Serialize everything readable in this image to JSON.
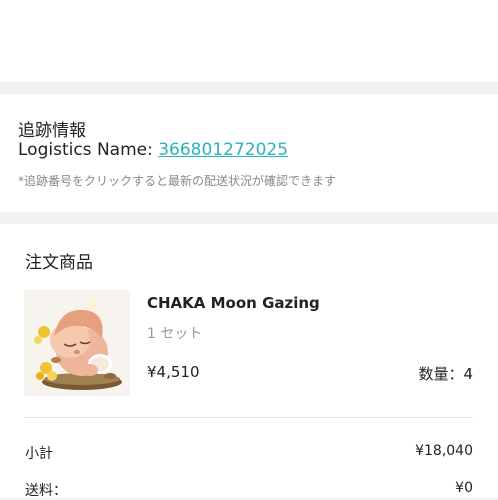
{
  "tracking": {
    "heading": "追跡情報",
    "logistics_label": "Logistics Name: ",
    "tracking_number": "366801272025",
    "note": "*追跡番号をクリックすると最新の配送状況が確認できます"
  },
  "order": {
    "heading": "注文商品",
    "product": {
      "name": "CHAKA Moon Gazing",
      "variant": "1 セット",
      "price": "¥4,510",
      "quantity": "数量：4"
    },
    "summary": {
      "subtotal_label": "小計",
      "subtotal_value": "¥18,040",
      "shipping_label": "送料：",
      "shipping_value": "¥0"
    }
  },
  "colors": {
    "link": "#2ab3bf",
    "background": "#f2f2f2",
    "card": "#ffffff"
  }
}
